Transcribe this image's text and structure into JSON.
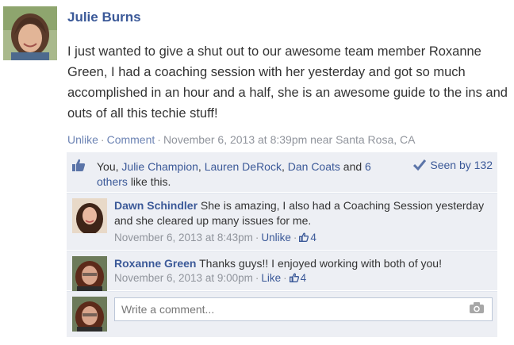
{
  "post": {
    "author": "Julie Burns",
    "text": "I just wanted to give a shut out to our awesome team member Roxanne Green, I had a coaching session with her yesterday and got so much accomplished in an hour and a half, she is an awesome guide to the ins and outs of all this techie stuff!",
    "unlike_label": "Unlike",
    "comment_label": "Comment",
    "timestamp": "November 6, 2013 at 8:39pm near Santa Rosa, CA"
  },
  "likes": {
    "you": "You,",
    "names": [
      "Julie Champion",
      "Lauren DeRock",
      "Dan Coats"
    ],
    "sep1": ",",
    "sep2": "and",
    "others": "6 others",
    "suffix": "like this.",
    "seen": "Seen by 132"
  },
  "comments": [
    {
      "author": "Dawn Schindler",
      "text": "She is amazing, I also had a Coaching Session yesterday and she cleared up many issues for me.",
      "time": "November 6, 2013 at 8:43pm",
      "action": "Unlike",
      "likes": "4"
    },
    {
      "author": "Roxanne Green",
      "text": "Thanks guys!! I enjoyed working with both of you!",
      "time": "November 6, 2013 at 9:00pm",
      "action": "Like",
      "likes": "4"
    }
  ],
  "composer": {
    "placeholder": "Write a comment..."
  },
  "colors": {
    "link": "#3b5998",
    "ufi_background": "#edeff4",
    "meta": "#90949c"
  }
}
